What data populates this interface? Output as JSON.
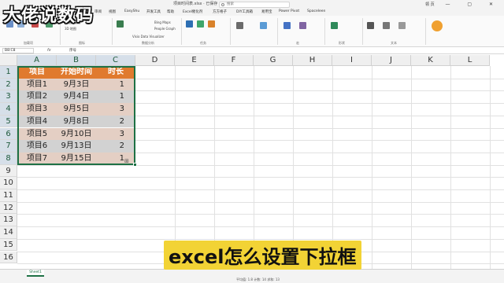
{
  "watermark": "大佬说数码",
  "title_bar": {
    "file_name": "项目时间表.xlsx · 已保存",
    "search_placeholder": "搜索",
    "user": "领 页",
    "window_controls": "—  ▢  ✕"
  },
  "menu_tabs": [
    "文件",
    "开始",
    "插入",
    "页面布局",
    "公式",
    "数据",
    "审阅",
    "视图",
    "EasyShu",
    "开发工具",
    "帮助",
    "Excel催化剂",
    "方方格子",
    "DIY工具箱",
    "易用宝",
    "Power Pivot",
    "Spaceleen"
  ],
  "ribbon_groups": [
    "加载项",
    "图标",
    "数据分析",
    "任务",
    "宏",
    "形状",
    "文本"
  ],
  "ribbon_buttons": [
    "数据透视图",
    "3D 地图",
    "Visio Data Visualizer",
    "Bing Maps",
    "People Graph",
    "图片",
    "形状",
    "文本框",
    "艺术字"
  ],
  "formula_bar": {
    "name_box": "B8:C8",
    "fx": "fx",
    "value": "序号"
  },
  "columns": [
    "A",
    "B",
    "C",
    "D",
    "E",
    "F",
    "G",
    "H",
    "I",
    "J",
    "K",
    "L"
  ],
  "rows": [
    "1",
    "2",
    "3",
    "4",
    "5",
    "6",
    "7",
    "8",
    "9",
    "10",
    "11",
    "12",
    "13",
    "14",
    "15",
    "16"
  ],
  "table": {
    "headers": [
      "项目",
      "开始时间",
      "时长"
    ],
    "rows": [
      [
        "项目1",
        "9月3日",
        "1"
      ],
      [
        "项目2",
        "9月4日",
        "1"
      ],
      [
        "项目3",
        "9月5日",
        "3"
      ],
      [
        "项目4",
        "9月8日",
        "2"
      ],
      [
        "项目5",
        "9月10日",
        "3"
      ],
      [
        "项目6",
        "9月13日",
        "2"
      ],
      [
        "项目7",
        "9月15日",
        "1"
      ]
    ]
  },
  "colors": {
    "header_fill": "#e07a2e",
    "odd_row_fill": "#e4cfc4",
    "even_row_fill": "#d2d2d2",
    "selection": "#1e7145",
    "caption_bg": "#f2d335"
  },
  "sheet_tab": "Sheet1",
  "status": "平均值: 1.8  计数: 14  求和: 13",
  "caption": "excel怎么设置下拉框"
}
